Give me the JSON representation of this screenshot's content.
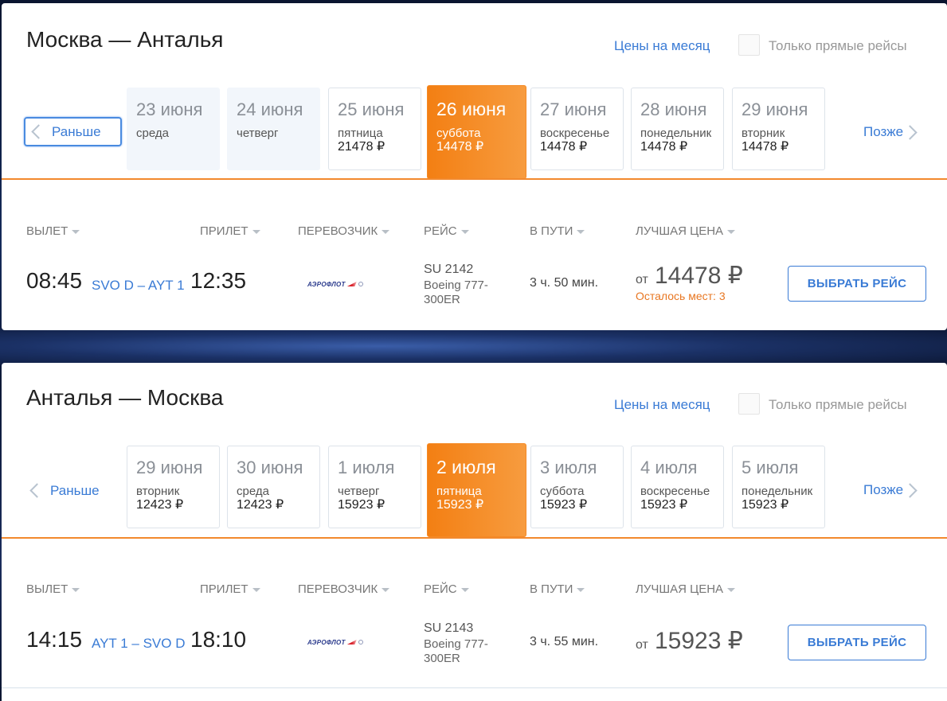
{
  "sections": [
    {
      "route_title": "Москва — Анталья",
      "month_link": "Цены на месяц",
      "direct_only_label": "Только прямые рейсы",
      "prev_label": "Раньше",
      "next_label": "Позже",
      "dates": [
        {
          "date": "23 июня",
          "day": "среда",
          "price": "",
          "state": "muted"
        },
        {
          "date": "24 июня",
          "day": "четверг",
          "price": "",
          "state": "muted"
        },
        {
          "date": "25 июня",
          "day": "пятница",
          "price": "21478 ₽",
          "state": "normal"
        },
        {
          "date": "26 июня",
          "day": "суббота",
          "price": "14478 ₽",
          "state": "active"
        },
        {
          "date": "27 июня",
          "day": "воскресенье",
          "price": "14478 ₽",
          "state": "normal"
        },
        {
          "date": "28 июня",
          "day": "понедельник",
          "price": "14478 ₽",
          "state": "normal"
        },
        {
          "date": "29 июня",
          "day": "вторник",
          "price": "14478 ₽",
          "state": "normal"
        }
      ],
      "headers": {
        "departure": "ВЫЛЕТ",
        "arrival": "ПРИЛЕТ",
        "carrier": "ПЕРЕВОЗЧИК",
        "flight": "РЕЙС",
        "duration": "В ПУТИ",
        "best_price": "ЛУЧШАЯ ЦЕНА"
      },
      "flight": {
        "dep_time": "08:45",
        "airports": "SVO D – AYT 1",
        "arr_time": "12:35",
        "carrier_logo_text": "АЭРОФЛОТ",
        "flight_number": "SU 2142",
        "aircraft": "Boeing 777-300ER",
        "duration": "3 ч. 50 мин.",
        "price_prefix": "от",
        "price": "14478 ₽",
        "seats_left": "Осталось мест: 3",
        "select_button": "ВЫБРАТЬ РЕЙС"
      }
    },
    {
      "route_title": "Анталья — Москва",
      "month_link": "Цены на месяц",
      "direct_only_label": "Только прямые рейсы",
      "prev_label": "Раньше",
      "next_label": "Позже",
      "dates": [
        {
          "date": "29 июня",
          "day": "вторник",
          "price": "12423 ₽",
          "state": "normal"
        },
        {
          "date": "30 июня",
          "day": "среда",
          "price": "12423 ₽",
          "state": "normal"
        },
        {
          "date": "1 июля",
          "day": "четверг",
          "price": "15923 ₽",
          "state": "normal"
        },
        {
          "date": "2 июля",
          "day": "пятница",
          "price": "15923 ₽",
          "state": "active"
        },
        {
          "date": "3 июля",
          "day": "суббота",
          "price": "15923 ₽",
          "state": "normal"
        },
        {
          "date": "4 июля",
          "day": "воскресенье",
          "price": "15923 ₽",
          "state": "normal"
        },
        {
          "date": "5 июля",
          "day": "понедельник",
          "price": "15923 ₽",
          "state": "normal"
        }
      ],
      "headers": {
        "departure": "ВЫЛЕТ",
        "arrival": "ПРИЛЕТ",
        "carrier": "ПЕРЕВОЗЧИК",
        "flight": "РЕЙС",
        "duration": "В ПУТИ",
        "best_price": "ЛУЧШАЯ ЦЕНА"
      },
      "flight": {
        "dep_time": "14:15",
        "airports": "AYT 1 – SVO D",
        "arr_time": "18:10",
        "carrier_logo_text": "АЭРОФЛОТ",
        "flight_number": "SU 2143",
        "aircraft": "Boeing 777-300ER",
        "duration": "3 ч. 55 мин.",
        "price_prefix": "от",
        "price": "15923 ₽",
        "seats_left": "",
        "select_button": "ВЫБРАТЬ РЕЙС"
      }
    }
  ],
  "colors": {
    "accent_orange": "#f37f13",
    "link_blue": "#3a7bd5"
  }
}
